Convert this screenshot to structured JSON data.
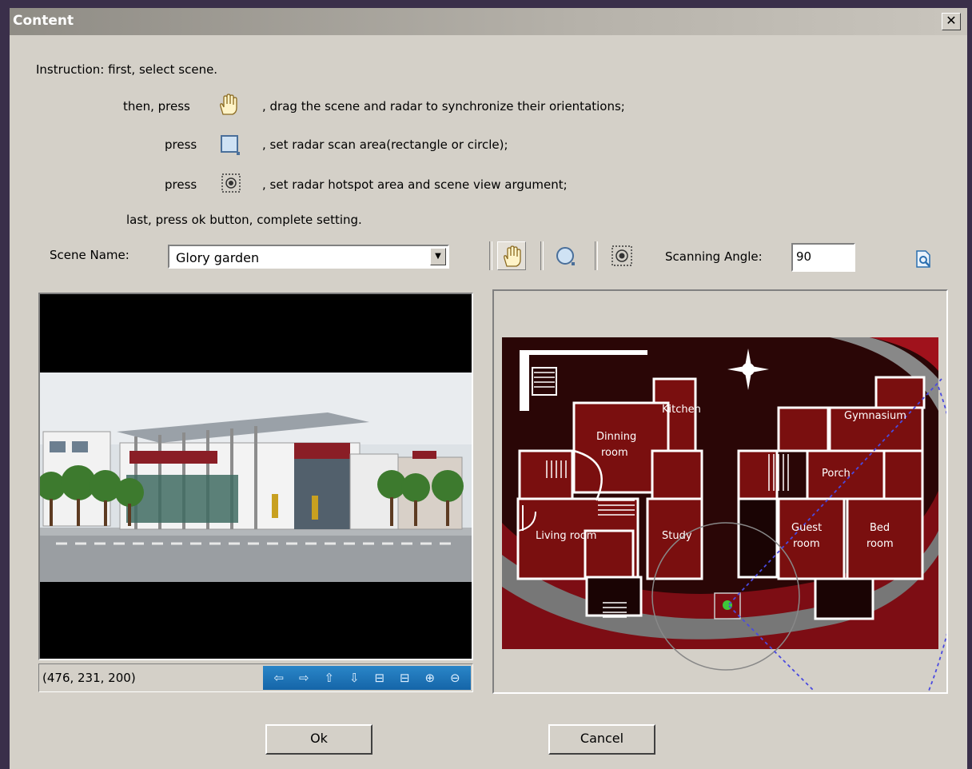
{
  "window": {
    "title": "Content",
    "close_glyph": "✕"
  },
  "instructions": {
    "line1": "Instruction: first, select scene.",
    "line2_prefix": "then, press",
    "line2_suffix": ", drag the scene and radar to synchronize their orientations;",
    "line3_prefix": "press",
    "line3_suffix": ", set radar scan area(rectangle or circle);",
    "line4_prefix": "press",
    "line4_suffix": ", set radar hotspot area and scene view argument;",
    "line5": "last, press ok button, complete setting."
  },
  "scene": {
    "label": "Scene Name:",
    "value": "Glory garden"
  },
  "toolbar": {
    "tools": [
      "hand-icon",
      "circle-scan-icon",
      "hotspot-icon"
    ],
    "angle_label": "Scanning Angle:",
    "angle_value": "90",
    "preview_icon": "preview-icon"
  },
  "status": {
    "coords": "(476, 231, 200)",
    "nav_icons": [
      "⇦",
      "⇨",
      "⇧",
      "⇩",
      "⊟",
      "⊟",
      "⊕",
      "⊖"
    ]
  },
  "floorplan": {
    "rooms": [
      "Kitchen",
      "Dinning",
      "room",
      "Living room",
      "Study",
      "Porch",
      "Gymnasium",
      "Guest",
      "room",
      "Bed",
      "room"
    ]
  },
  "buttons": {
    "ok": "Ok",
    "cancel": "Cancel"
  },
  "colors": {
    "accent": "#1565a8",
    "floor": "#7a0f0f",
    "dialog": "#d4d0c8"
  }
}
